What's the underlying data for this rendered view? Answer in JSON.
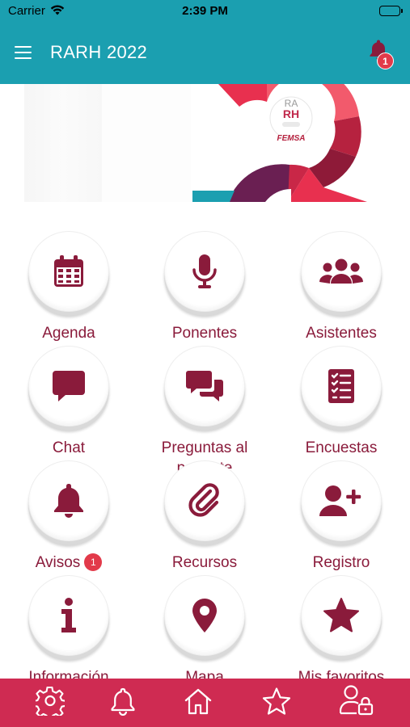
{
  "status_bar": {
    "carrier": "Carrier",
    "time": "2:39 PM"
  },
  "header": {
    "title": "RARH 2022",
    "notification_count": "1"
  },
  "banner": {
    "logo_line1": "RA",
    "logo_line2": "RH",
    "brand": "FEMSA"
  },
  "grid": [
    {
      "label": "Agenda",
      "icon": "calendar-icon"
    },
    {
      "label": "Ponentes",
      "icon": "microphone-icon"
    },
    {
      "label": "Asistentes",
      "icon": "users-icon"
    },
    {
      "label": "Chat",
      "icon": "chat-bubble-icon"
    },
    {
      "label": "Preguntas al ponente",
      "icon": "comments-icon"
    },
    {
      "label": "Encuestas",
      "icon": "survey-list-icon"
    },
    {
      "label": "Avisos",
      "icon": "bell-icon",
      "badge": "1"
    },
    {
      "label": "Recursos",
      "icon": "paperclip-icon"
    },
    {
      "label": "Registro",
      "icon": "user-plus-icon"
    },
    {
      "label": "Información",
      "icon": "info-icon"
    },
    {
      "label": "Mapa",
      "icon": "map-marker-icon"
    },
    {
      "label": "Mis favoritos",
      "icon": "star-icon"
    }
  ],
  "tabbar": [
    {
      "icon": "settings-gear-icon"
    },
    {
      "icon": "bell-outline-icon"
    },
    {
      "icon": "home-icon"
    },
    {
      "icon": "star-outline-icon"
    },
    {
      "icon": "user-lock-icon"
    }
  ],
  "colors": {
    "primary": "#1b9fb0",
    "accent": "#8a1b3b",
    "tabbar": "#cf2b52",
    "badge": "#e23a4a"
  }
}
